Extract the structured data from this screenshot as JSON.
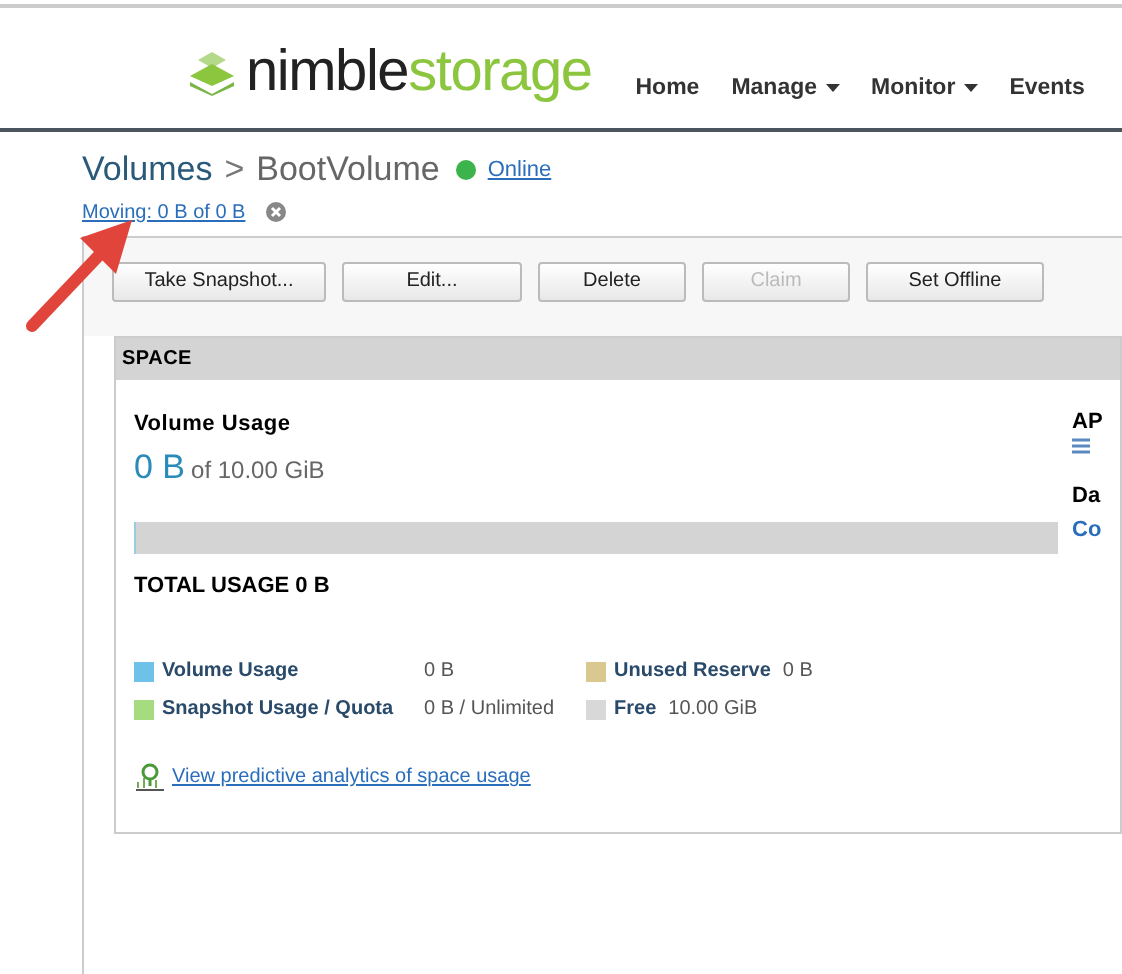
{
  "header": {
    "logo": {
      "part1": "nimble",
      "part2": "storage"
    },
    "nav": [
      {
        "label": "Home",
        "dropdown": false
      },
      {
        "label": "Manage",
        "dropdown": true
      },
      {
        "label": "Monitor",
        "dropdown": true
      },
      {
        "label": "Events",
        "dropdown": false
      }
    ]
  },
  "breadcrumb": {
    "parent": "Volumes",
    "separator": ">",
    "current": "BootVolume",
    "status": {
      "text": "Online",
      "color": "#3cb44b"
    }
  },
  "moving": {
    "text": "Moving: 0 B of 0 B"
  },
  "actions": [
    {
      "label": "Take Snapshot...",
      "disabled": false
    },
    {
      "label": "Edit...",
      "disabled": false
    },
    {
      "label": "Delete",
      "disabled": false
    },
    {
      "label": "Claim",
      "disabled": true
    },
    {
      "label": "Set Offline",
      "disabled": false
    }
  ],
  "space": {
    "title": "SPACE",
    "usage_title": "Volume Usage",
    "used": "0 B",
    "of": "of 10.00 GiB",
    "level": 0,
    "total": "TOTAL USAGE 0 B",
    "legend": [
      [
        {
          "label": "Volume Usage",
          "value": "0 B",
          "color": "#6ec1e8"
        },
        {
          "label": "Snapshot Usage / Quota",
          "value": "0 B / Unlimited",
          "color": "#a6dc80"
        }
      ],
      [
        {
          "label": "Unused Reserve",
          "value": "0 B",
          "color": "#d9c88f"
        },
        {
          "label": "Free",
          "value": "10.00 GiB",
          "color": "#d8d8d8"
        }
      ]
    ],
    "analytics_link": "View predictive analytics of space usage",
    "side": [
      {
        "kind": "heading",
        "text": "AP"
      },
      {
        "kind": "heading",
        "text": "Da"
      },
      {
        "kind": "link",
        "text": "Co"
      }
    ]
  }
}
